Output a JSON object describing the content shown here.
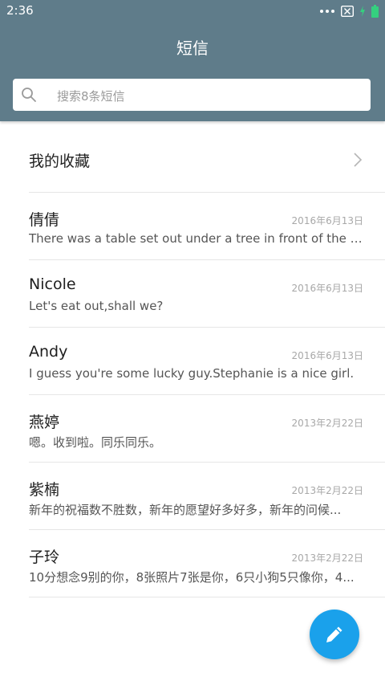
{
  "status_bar": {
    "time": "2:36"
  },
  "header": {
    "title": "短信"
  },
  "search": {
    "placeholder": "搜索8条短信"
  },
  "favorites": {
    "label": "我的收藏"
  },
  "conversations": [
    {
      "name": "倩倩",
      "date": "2016年6月13日",
      "preview": "There was a table set out under a tree in front of the ho..."
    },
    {
      "name": "Nicole",
      "date": "2016年6月13日",
      "preview": "Let's eat out,shall we?"
    },
    {
      "name": "Andy",
      "date": "2016年6月13日",
      "preview": "I guess you're some lucky guy.Stephanie is a nice girl."
    },
    {
      "name": "燕婷",
      "date": "2013年2月22日",
      "preview": "嗯。收到啦。同乐同乐。"
    },
    {
      "name": "紫楠",
      "date": "2013年2月22日",
      "preview": "新年的祝福数不胜数，新年的愿望好多好多，新年的问候..."
    },
    {
      "name": "子玲",
      "date": "2013年2月22日",
      "preview": "10分想念9别的你，8张照片7张是你，6只小狗5只像你，4..."
    }
  ],
  "colors": {
    "header": "#5f7c8a",
    "fab": "#1aa1eb",
    "battery": "#35d07f"
  },
  "icons": {
    "search": "search-icon",
    "chevron": "chevron-right-icon",
    "fab": "pencil-icon"
  }
}
